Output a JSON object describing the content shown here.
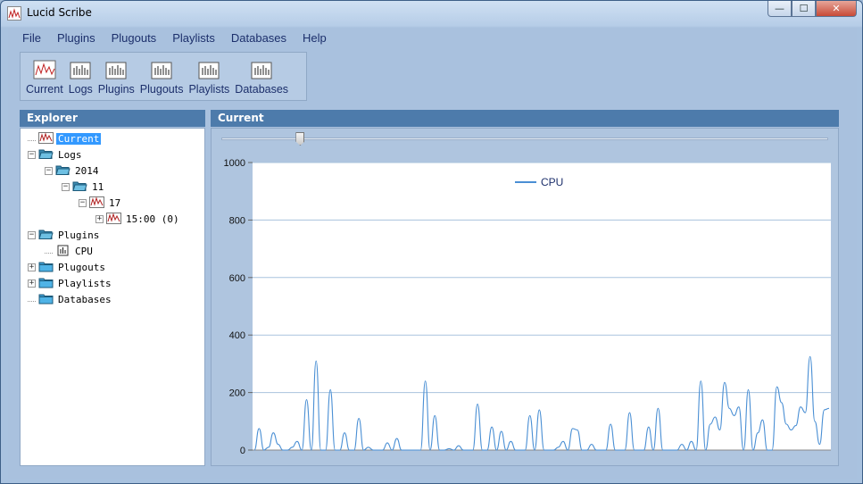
{
  "window": {
    "title": "Lucid Scribe",
    "buttons": {
      "minimize": "—",
      "maximize": "☐",
      "close": "✕"
    }
  },
  "menu": [
    "File",
    "Plugins",
    "Plugouts",
    "Playlists",
    "Databases",
    "Help"
  ],
  "toolbar": [
    "Current",
    "Logs",
    "Plugins",
    "Plugouts",
    "Playlists",
    "Databases"
  ],
  "explorer": {
    "title": "Explorer",
    "items": [
      {
        "label": "Current",
        "icon": "graph-icon",
        "depth": 0,
        "expander": "",
        "selected": true
      },
      {
        "label": "Logs",
        "icon": "folder-open-icon",
        "depth": 0,
        "expander": "−"
      },
      {
        "label": "2014",
        "icon": "folder-open-icon",
        "depth": 1,
        "expander": "−"
      },
      {
        "label": "11",
        "icon": "folder-open-icon",
        "depth": 2,
        "expander": "−"
      },
      {
        "label": "17",
        "icon": "graph-icon",
        "depth": 3,
        "expander": "−"
      },
      {
        "label": "15:00 (0)",
        "icon": "graph-icon",
        "depth": 4,
        "expander": "+"
      },
      {
        "label": "Plugins",
        "icon": "folder-open-icon",
        "depth": 0,
        "expander": "−"
      },
      {
        "label": "CPU",
        "icon": "plugin-icon",
        "depth": 1,
        "expander": ""
      },
      {
        "label": "Plugouts",
        "icon": "folder-icon",
        "depth": 0,
        "expander": "+"
      },
      {
        "label": "Playlists",
        "icon": "folder-icon",
        "depth": 0,
        "expander": "+"
      },
      {
        "label": "Databases",
        "icon": "folder-icon",
        "depth": 0,
        "expander": ""
      }
    ]
  },
  "current": {
    "title": "Current",
    "slider_position": 0.13
  },
  "chart_data": {
    "type": "line",
    "ylim": [
      0,
      1000
    ],
    "yticks": [
      0,
      200,
      400,
      600,
      800,
      1000
    ],
    "grid": true,
    "legend_position": "top-center",
    "series": [
      {
        "name": "CPU",
        "color": "#4a8fd4",
        "values": [
          0,
          75,
          0,
          10,
          60,
          20,
          0,
          0,
          10,
          30,
          0,
          175,
          0,
          310,
          0,
          0,
          210,
          0,
          0,
          60,
          0,
          0,
          110,
          0,
          10,
          0,
          0,
          0,
          25,
          0,
          40,
          0,
          0,
          0,
          0,
          0,
          240,
          0,
          120,
          0,
          0,
          5,
          0,
          15,
          0,
          0,
          0,
          160,
          0,
          0,
          80,
          0,
          65,
          0,
          30,
          0,
          0,
          0,
          120,
          0,
          140,
          0,
          0,
          0,
          10,
          30,
          0,
          75,
          70,
          0,
          0,
          20,
          0,
          0,
          0,
          90,
          0,
          0,
          0,
          130,
          0,
          0,
          0,
          80,
          0,
          145,
          0,
          0,
          0,
          0,
          20,
          0,
          30,
          0,
          240,
          0,
          90,
          115,
          70,
          235,
          145,
          120,
          150,
          0,
          210,
          0,
          60,
          105,
          0,
          0,
          220,
          165,
          90,
          70,
          85,
          150,
          130,
          325,
          100,
          20,
          140,
          145
        ]
      }
    ]
  }
}
